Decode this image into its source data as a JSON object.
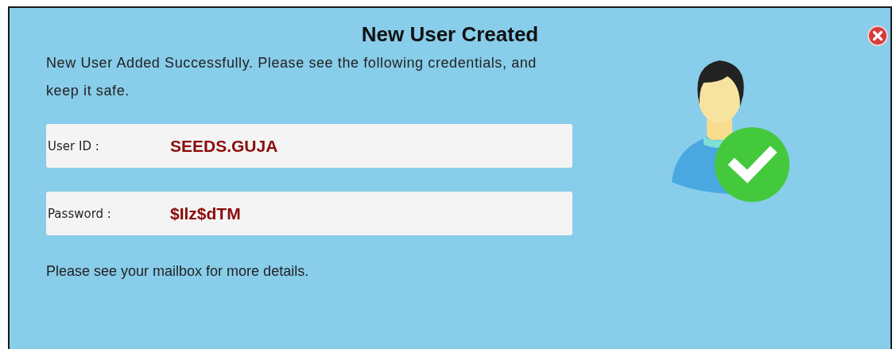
{
  "dialog": {
    "title": "New User Created",
    "message": "New User Added Successfully. Please see the following credentials, and keep it safe.",
    "fields": [
      {
        "label": "User ID :",
        "value": "SEEDS.GUJA"
      },
      {
        "label": "Password :",
        "value": "$Ilz$dTM"
      }
    ],
    "footer": "Please see your mailbox for more details."
  }
}
